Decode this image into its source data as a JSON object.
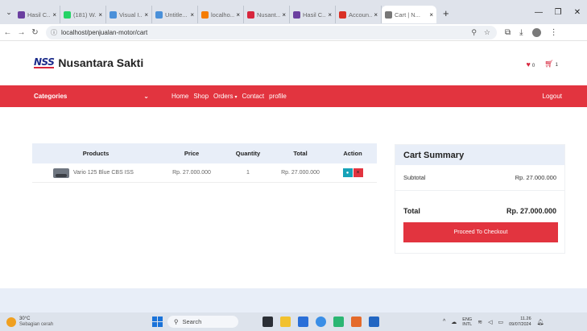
{
  "browser": {
    "tabs": [
      {
        "label": "Hasil C...",
        "icon": "form-icon",
        "color": "#6b3fa0",
        "active": false
      },
      {
        "label": "(181) W...",
        "icon": "whatsapp-icon",
        "color": "#25d366",
        "active": false
      },
      {
        "label": "Visual I...",
        "icon": "chrome-icon",
        "color": "#4a90d9",
        "active": false
      },
      {
        "label": "Untitle...",
        "icon": "chrome-icon",
        "color": "#4a90d9",
        "active": false
      },
      {
        "label": "localho...",
        "icon": "xampp-icon",
        "color": "#f57c00",
        "active": false
      },
      {
        "label": "Nusant...",
        "icon": "nss-icon",
        "color": "#d7263d",
        "active": false
      },
      {
        "label": "Hasil C...",
        "icon": "form-icon",
        "color": "#6b3fa0",
        "active": false
      },
      {
        "label": "Accoun...",
        "icon": "gmail-icon",
        "color": "#d93025",
        "active": false
      },
      {
        "label": "Cart | N...",
        "icon": "globe-icon",
        "color": "#777777",
        "active": true
      }
    ],
    "url": "localhost/penjualan-motor/cart"
  },
  "header": {
    "logo_text": "NSS",
    "brand": "Nusantara Sakti",
    "wishlist_count": "0",
    "cart_count": "1"
  },
  "nav": {
    "categories": "Categories",
    "items": [
      "Home",
      "Shop",
      "Orders",
      "Contact",
      "profile"
    ],
    "orders_caret": "▾",
    "logout": "Logout"
  },
  "cart": {
    "columns": [
      "Products",
      "Price",
      "Quantity",
      "Total",
      "Action"
    ],
    "rows": [
      {
        "product": "Vario 125 Blue CBS ISS",
        "price": "Rp. 27.000.000",
        "quantity": "1",
        "total": "Rp. 27.000.000"
      }
    ]
  },
  "summary": {
    "title": "Cart Summary",
    "subtotal_label": "Subtotal",
    "subtotal_value": "Rp. 27.000.000",
    "total_label": "Total",
    "total_value": "Rp. 27.000.000",
    "checkout_label": "Proceed To Checkout"
  },
  "taskbar": {
    "weather_temp": "30°C",
    "weather_desc": "Sebagian cerah",
    "search": "Search",
    "lang_top": "ENG",
    "lang_bottom": "INTL",
    "time": "11.26",
    "date": "09/07/2024"
  },
  "colors": {
    "brand_red": "#e2343f",
    "light_blue": "#e8eef8",
    "view_button": "#17a2b8"
  }
}
